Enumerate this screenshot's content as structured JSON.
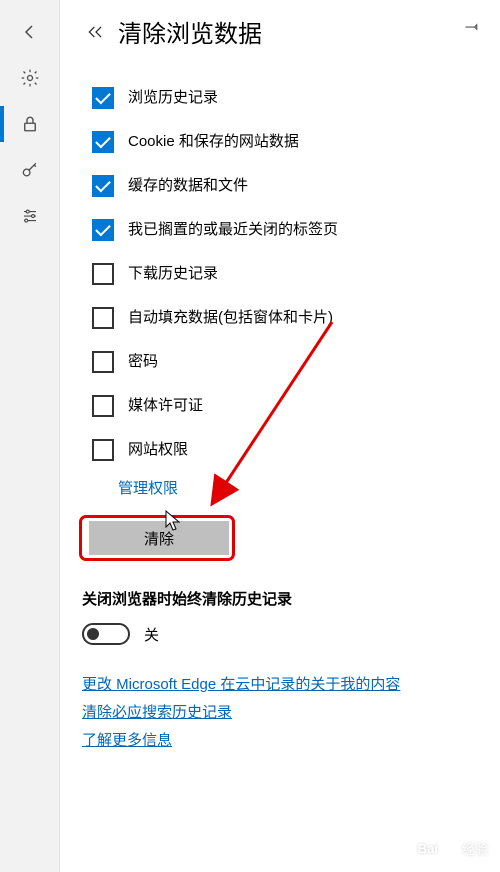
{
  "title": "清除浏览数据",
  "options": [
    {
      "label": "浏览历史记录",
      "checked": true
    },
    {
      "label": "Cookie 和保存的网站数据",
      "checked": true
    },
    {
      "label": "缓存的数据和文件",
      "checked": true
    },
    {
      "label": "我已搁置的或最近关闭的标签页",
      "checked": true
    },
    {
      "label": "下载历史记录",
      "checked": false
    },
    {
      "label": "自动填充数据(包括窗体和卡片)",
      "checked": false
    },
    {
      "label": "密码",
      "checked": false
    },
    {
      "label": "媒体许可证",
      "checked": false
    },
    {
      "label": "网站权限",
      "checked": false
    }
  ],
  "manage_link": "管理权限",
  "clear_button": "清除",
  "always_clear_heading": "关闭浏览器时始终清除历史记录",
  "toggle_state": "关",
  "links": [
    "更改 Microsoft Edge 在云中记录的关于我的内容",
    "清除必应搜索历史记录",
    "了解更多信息"
  ],
  "watermark": "经验"
}
